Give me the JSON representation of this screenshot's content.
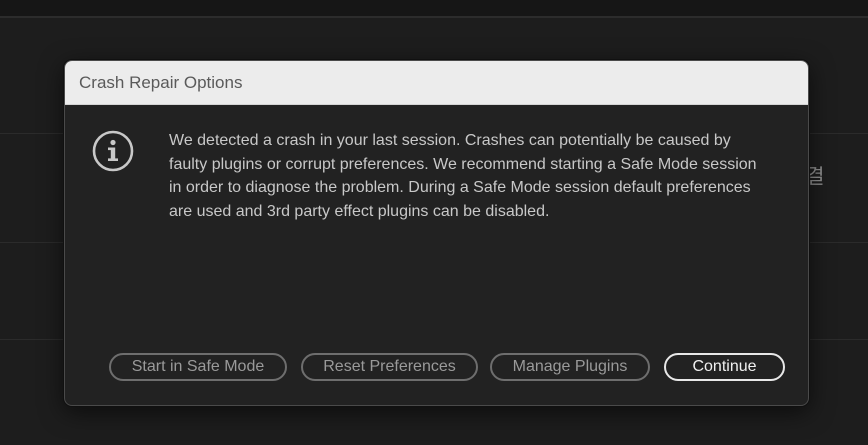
{
  "background": {
    "side_text": "결"
  },
  "dialog": {
    "title": "Crash Repair Options",
    "icon": "info-icon",
    "message": "We detected a crash in your last session. Crashes can potentially be caused by faulty plugins or corrupt preferences. We recommend starting a Safe Mode session in order to diagnose the problem. During a Safe Mode session default preferences are used and 3rd party effect plugins can be disabled.",
    "buttons": {
      "safe_mode": "Start in Safe Mode",
      "reset_preferences": "Reset Preferences",
      "manage_plugins": "Manage Plugins",
      "continue": "Continue"
    }
  },
  "colors": {
    "dialog_bg": "#222222",
    "titlebar_bg": "#ececec",
    "button_border": "#6e6e6e",
    "primary_button_border": "#e8e8e8"
  }
}
